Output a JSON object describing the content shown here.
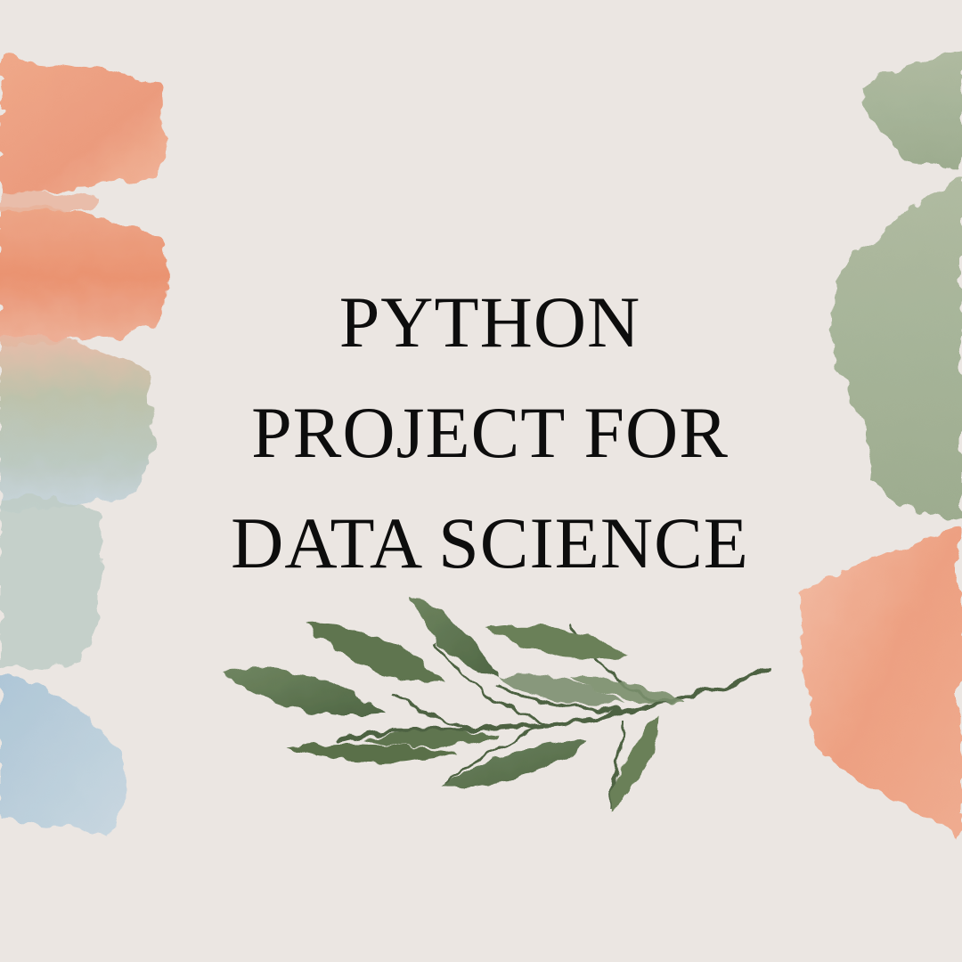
{
  "title": {
    "line1": "PYTHON",
    "line2": "PROJECT FOR",
    "line3": "DATA SCIENCE"
  },
  "colors": {
    "background": "#ebe6e2",
    "text": "#0d0d0d",
    "peach_stroke": "#ec9b7c",
    "sage_stroke": "#a4b293",
    "blue_stroke": "#a9c2d3",
    "leaf_green": "#5f7550",
    "stem_green": "#4d6243"
  },
  "decorations": {
    "left_strokes": [
      "peach",
      "peach",
      "sage",
      "blue"
    ],
    "right_strokes": [
      "sage",
      "sage",
      "peach"
    ],
    "branch": "leaf-branch"
  }
}
